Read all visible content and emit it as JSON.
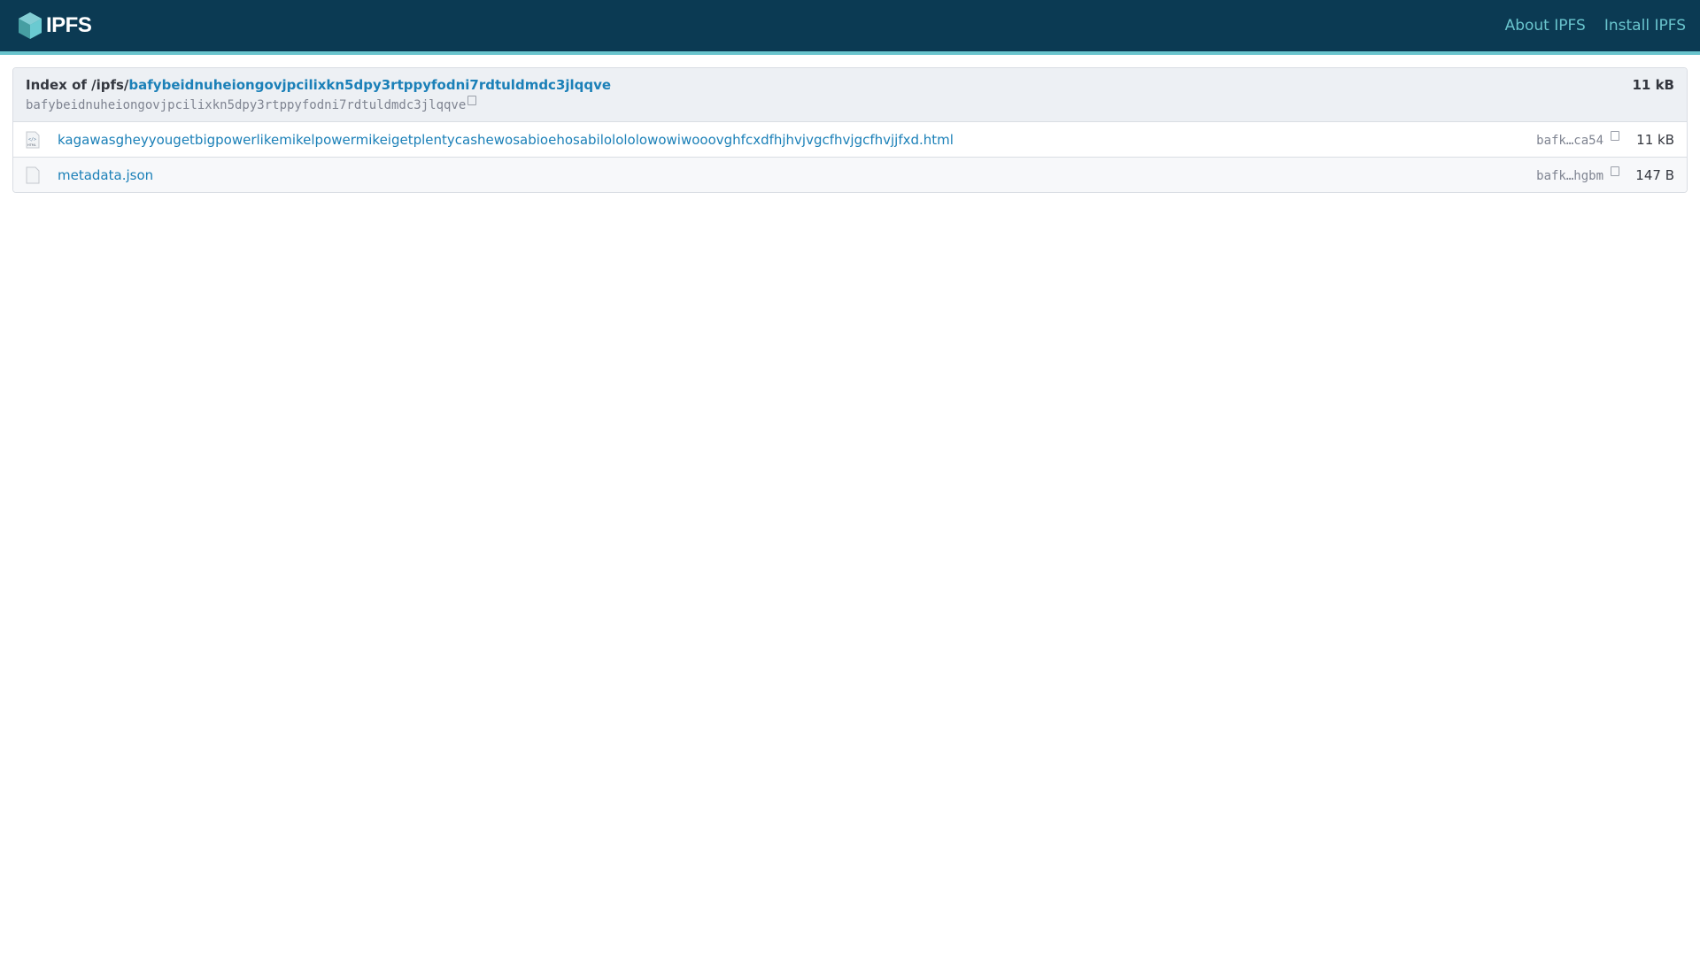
{
  "header": {
    "logo_text": "IPFS",
    "nav": [
      {
        "label": "About IPFS"
      },
      {
        "label": "Install IPFS"
      }
    ]
  },
  "index": {
    "prefix": "Index of /ipfs/",
    "cid_link": "bafybeidnuheiongovjpcilixkn5dpy3rtppyfodni7rdtuldmdc3jlqqve",
    "cid": "bafybeidnuheiongovjpcilixkn5dpy3rtppyfodni7rdtuldmdc3jlqqve",
    "total_size": "11 kB"
  },
  "files": [
    {
      "name": "kagawasgheyyougetbigpowerlikemikelpowermikeigetplentycashewosabioehosabilolololowowiwooovghfcxdfhjhvjvgcfhvjgcfhvjjfxd.html",
      "hash": "bafk…ca54",
      "size": "11 kB",
      "icon": "html-file-icon"
    },
    {
      "name": "metadata.json",
      "hash": "bafk…hgbm",
      "size": "147 B",
      "icon": "file-icon"
    }
  ]
}
